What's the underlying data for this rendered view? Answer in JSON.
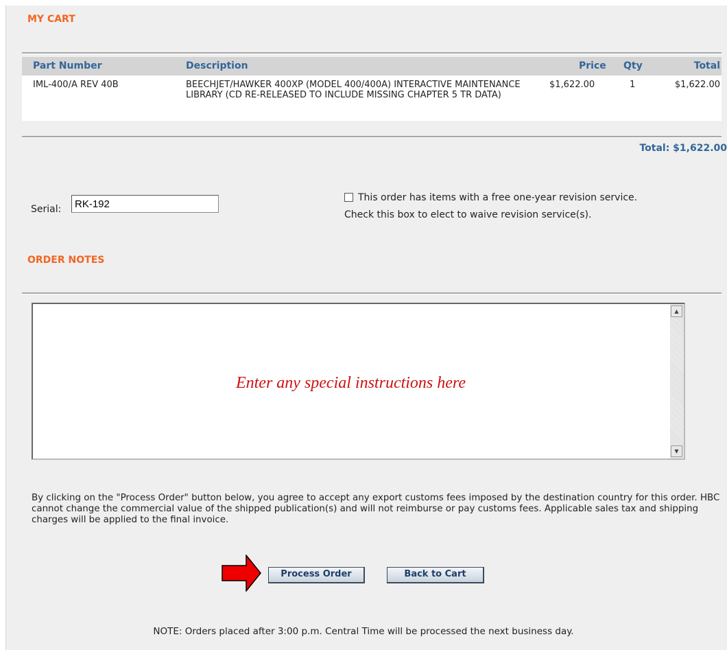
{
  "cart": {
    "title": "MY CART",
    "columns": {
      "part": "Part Number",
      "desc": "Description",
      "price": "Price",
      "qty": "Qty",
      "total": "Total"
    },
    "items": [
      {
        "part": "IML-400/A REV 40B",
        "desc": "BEECHJET/HAWKER 400XP (MODEL 400/400A) INTERACTIVE MAINTENANCE LIBRARY (CD RE-RELEASED TO INCLUDE MISSING CHAPTER 5 TR DATA)",
        "price": "$1,622.00",
        "qty": "1",
        "total": "$1,622.00"
      }
    ],
    "grand_total": "Total: $1,622.00"
  },
  "serial": {
    "label": "Serial:",
    "value": "RK-192"
  },
  "revision": {
    "line1": "This order has items with a free one-year revision service.",
    "line2": "Check this box to elect to waive revision service(s).",
    "checked": false
  },
  "notes": {
    "title": "ORDER NOTES",
    "placeholder": "Enter any special instructions here"
  },
  "disclaimer": "By clicking on the \"Process Order\" button below, you agree to accept any export customs fees imposed by the destination country for this order. HBC cannot change the commercial value of the shipped publication(s) and will not reimburse or pay customs fees. Applicable sales tax and shipping charges will be applied to the final invoice.",
  "buttons": {
    "process": "Process Order",
    "back": "Back to Cart"
  },
  "footer_note": "NOTE: Orders placed after 3:00 p.m. Central Time will be processed the next business day.",
  "colors": {
    "accent": "#f26522",
    "header_text": "#336699",
    "arrow": "#ee0000"
  },
  "icons": {
    "arrow": "red-arrow-icon",
    "scroll_up": "scroll-up-icon",
    "scroll_down": "scroll-down-icon"
  }
}
